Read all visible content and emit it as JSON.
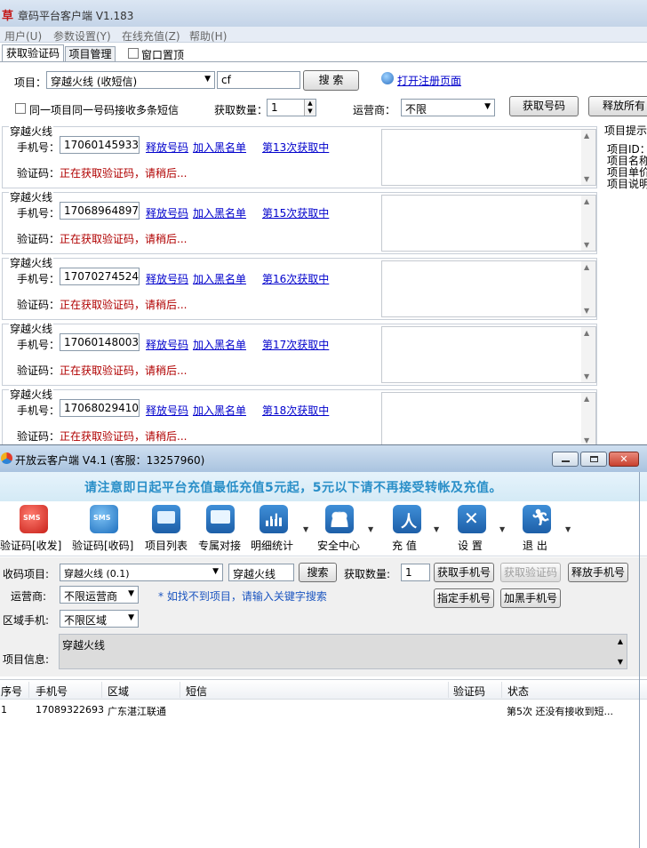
{
  "win1": {
    "logo": "草",
    "title": "章码平台客户端 V1.183",
    "menu": [
      "用户(U)",
      "参数设置(Y)",
      "在线充值(Z)",
      "帮助(H)"
    ],
    "tabs": {
      "get_code": "获取验证码",
      "project_mgmt": "项目管理"
    },
    "window_top_label": "窗口置顶",
    "project_label": "项目：",
    "project_value": "穿越火线 (收短信)",
    "search_value": "cf",
    "search_button": "搜 索",
    "register_link": "打开注册页面",
    "multi_sms_label": "同一项目同一号码接收多条短信",
    "count_label": "获取数量：",
    "count_value": "1",
    "operator_label": "运营商：",
    "operator_value": "不限",
    "get_number_button": "获取号码",
    "release_all_button": "释放所有",
    "hint": {
      "title": "项目提示",
      "lines": [
        "项目ID：",
        "项目名称",
        "项目单价",
        "项目说明"
      ]
    },
    "slot_labels": {
      "phone": "手机号：",
      "code": "验证码：",
      "release": "释放号码",
      "blacklist": "加入黑名单",
      "waiting": "正在获取验证码，请稍后..."
    },
    "slots": [
      {
        "name": "穿越火线",
        "phone": "17060145933",
        "attempt": "第13次获取中"
      },
      {
        "name": "穿越火线",
        "phone": "17068964897",
        "attempt": "第15次获取中"
      },
      {
        "name": "穿越火线",
        "phone": "17070274524",
        "attempt": "第16次获取中"
      },
      {
        "name": "穿越火线",
        "phone": "17060148003",
        "attempt": "第17次获取中"
      },
      {
        "name": "穿越火线",
        "phone": "17068029410",
        "attempt": "第18次获取中"
      }
    ]
  },
  "win2": {
    "title": "开放云客户端 V4.1 (客服：13257960)",
    "banner": "请注意即日起平台充值最低充值5元起，5元以下请不再接受转帐及充值。",
    "toolbar": [
      {
        "label": "验证码[收发]",
        "icon": "sms-red-icon",
        "color": "#d8302a"
      },
      {
        "label": "验证码[收码]",
        "icon": "sms-blue-icon",
        "color": "#2b78c8"
      },
      {
        "label": "项目列表",
        "icon": "monitor-list-icon",
        "color": "#2b78c8"
      },
      {
        "label": "专属对接",
        "icon": "monitor-icon",
        "color": "#2b78c8"
      },
      {
        "label": "明细统计",
        "icon": "bar-chart-icon",
        "color": "#2b78c8"
      },
      {
        "label": "安全中心",
        "icon": "users-icon",
        "color": "#2b78c8"
      },
      {
        "label": "充 值",
        "icon": "recharge-icon",
        "color": "#2b78c8"
      },
      {
        "label": "设 置",
        "icon": "tools-icon",
        "color": "#2b78c8"
      },
      {
        "label": "退 出",
        "icon": "exit-icon",
        "color": "#2b78c8"
      }
    ],
    "form": {
      "project_label": "收码项目:",
      "project_value": "穿越火线 (0.1)",
      "search_value": "穿越火线",
      "search_button": "搜索",
      "count_label": "获取数量:",
      "count_value": "1",
      "get_phone_button": "获取手机号",
      "get_code_button": "获取验证码",
      "release_phone_button": "释放手机号",
      "operator_label": "运营商:",
      "operator_value": "不限运营商",
      "hint": "* 如找不到项目，请输入关键字搜索",
      "assign_phone_button": "指定手机号",
      "blacklist_phone_button": "加黑手机号",
      "region_label": "区域手机:",
      "region_value": "不限区域",
      "info_label": "项目信息:",
      "info_value": "穿越火线"
    },
    "table": {
      "columns": [
        "序号",
        "手机号",
        "区域",
        "短信",
        "验证码",
        "状态"
      ],
      "rows": [
        {
          "index": "1",
          "phone": "17089322693",
          "region": "广东湛江联通",
          "sms": "",
          "code": "",
          "status": "第5次 还没有接收到短..."
        }
      ]
    }
  }
}
